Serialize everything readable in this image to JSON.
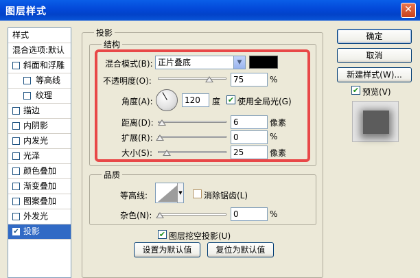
{
  "window": {
    "title": "图层样式",
    "close_icon": "close-icon"
  },
  "stylelist": {
    "header": "样式",
    "blend_default": "混合选项:默认",
    "items": [
      {
        "label": "斜面和浮雕",
        "checked": false
      },
      {
        "label": "等高线",
        "checked": false,
        "indent": true
      },
      {
        "label": "纹理",
        "checked": false,
        "indent": true
      },
      {
        "label": "描边",
        "checked": false
      },
      {
        "label": "内阴影",
        "checked": false
      },
      {
        "label": "内发光",
        "checked": false
      },
      {
        "label": "光泽",
        "checked": false
      },
      {
        "label": "颜色叠加",
        "checked": false
      },
      {
        "label": "渐变叠加",
        "checked": false
      },
      {
        "label": "图案叠加",
        "checked": false
      },
      {
        "label": "外发光",
        "checked": false
      },
      {
        "label": "投影",
        "checked": true,
        "selected": true
      }
    ]
  },
  "drop_shadow": {
    "title": "投影",
    "structure": {
      "title": "结构",
      "blend_mode_label": "混合模式(B):",
      "blend_mode_value": "正片叠底",
      "shadow_color": "#000000",
      "opacity_label": "不透明度(O):",
      "opacity_value": "75",
      "opacity_unit": "%",
      "opacity_fraction": 0.75,
      "angle_label": "角度(A):",
      "angle_value": "120",
      "angle_unit": "度",
      "global_light_label": "使用全局光(G)",
      "global_light_checked": true,
      "distance_label": "距离(D):",
      "distance_value": "6",
      "distance_unit": "像素",
      "spread_label": "扩展(R):",
      "spread_value": "0",
      "spread_unit": "%",
      "size_label": "大小(S):",
      "size_value": "25",
      "size_unit": "像素"
    },
    "quality": {
      "title": "品质",
      "contour_label": "等高线:",
      "antialias_label": "消除锯齿(L)",
      "antialias_checked": false,
      "noise_label": "杂色(N):",
      "noise_value": "0",
      "noise_unit": "%"
    },
    "knockout_label": "图层挖空投影(U)",
    "knockout_checked": true,
    "make_default_label": "设置为默认值",
    "reset_default_label": "复位为默认值"
  },
  "side": {
    "ok_label": "确定",
    "cancel_label": "取消",
    "new_style_label": "新建样式(W)...",
    "preview_label": "预览(V)",
    "preview_checked": true
  }
}
